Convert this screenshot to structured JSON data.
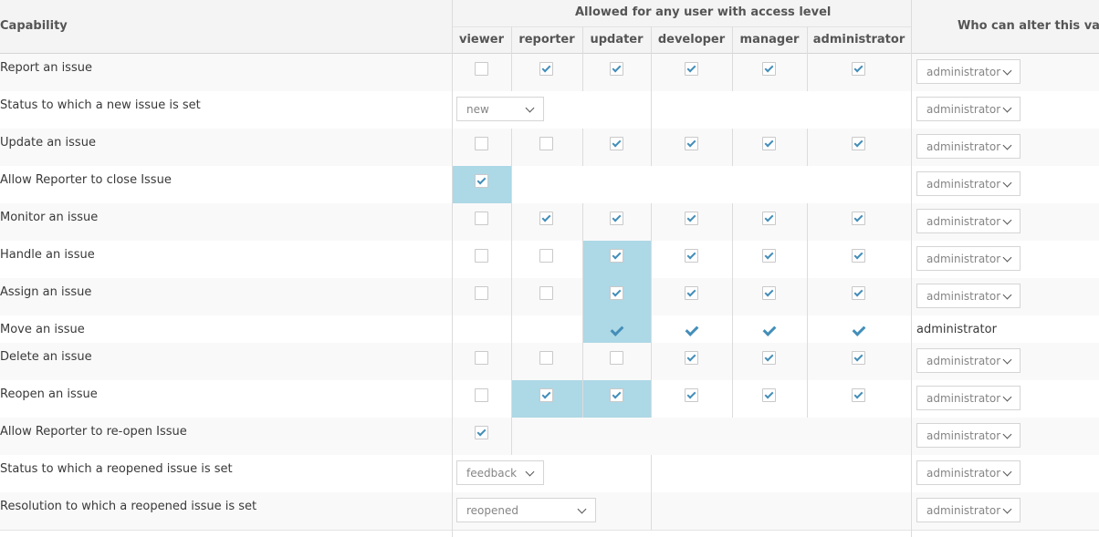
{
  "header": {
    "capability": "Capability",
    "allowed_group": "Allowed for any user with access level",
    "who_can_alter": "Who can alter this value",
    "levels": [
      "viewer",
      "reporter",
      "updater",
      "developer",
      "manager",
      "administrator"
    ]
  },
  "rows": [
    {
      "label": "Report an issue",
      "kind": "checks",
      "checks": [
        false,
        true,
        true,
        true,
        true,
        true
      ],
      "highlight": [
        false,
        false,
        false,
        false,
        false,
        false
      ],
      "alter": "administrator"
    },
    {
      "label": "Status to which a new issue is set",
      "kind": "select",
      "select_value": "new",
      "alter": "administrator"
    },
    {
      "label": "Update an issue",
      "kind": "checks",
      "checks": [
        false,
        false,
        true,
        true,
        true,
        true
      ],
      "highlight": [
        false,
        false,
        false,
        false,
        false,
        false
      ],
      "alter": "administrator"
    },
    {
      "label": "Allow Reporter to close Issue",
      "kind": "single",
      "checked": true,
      "highlight": true,
      "alter": "administrator"
    },
    {
      "label": "Monitor an issue",
      "kind": "checks",
      "checks": [
        false,
        true,
        true,
        true,
        true,
        true
      ],
      "highlight": [
        false,
        false,
        false,
        false,
        false,
        false
      ],
      "alter": "administrator"
    },
    {
      "label": "Handle an issue",
      "kind": "checks",
      "checks": [
        false,
        false,
        true,
        true,
        true,
        true
      ],
      "highlight": [
        false,
        false,
        true,
        false,
        false,
        false
      ],
      "alter": "administrator"
    },
    {
      "label": "Assign an issue",
      "kind": "checks",
      "checks": [
        false,
        false,
        true,
        true,
        true,
        true
      ],
      "highlight": [
        false,
        false,
        true,
        false,
        false,
        false
      ],
      "alter": "administrator"
    },
    {
      "label": "Move an issue",
      "kind": "ticks",
      "checks": [
        false,
        false,
        true,
        true,
        true,
        true
      ],
      "highlight": [
        false,
        false,
        true,
        false,
        false,
        false
      ],
      "alter": "administrator",
      "alter_plain": true
    },
    {
      "label": "Delete an issue",
      "kind": "checks",
      "checks": [
        false,
        false,
        false,
        true,
        true,
        true
      ],
      "highlight": [
        false,
        false,
        false,
        false,
        false,
        false
      ],
      "alter": "administrator"
    },
    {
      "label": "Reopen an issue",
      "kind": "checks",
      "checks": [
        false,
        true,
        true,
        true,
        true,
        true
      ],
      "highlight": [
        false,
        true,
        true,
        false,
        false,
        false
      ],
      "alter": "administrator"
    },
    {
      "label": "Allow Reporter to re-open Issue",
      "kind": "single",
      "checked": true,
      "highlight": false,
      "alter": "administrator"
    },
    {
      "label": "Status to which a reopened issue is set",
      "kind": "select",
      "select_value": "feedback",
      "alter": "administrator"
    },
    {
      "label": "Resolution to which a reopened issue is set",
      "kind": "select",
      "select_value": "reopened",
      "alter": "administrator"
    }
  ],
  "colors": {
    "accent": "#438eb9",
    "highlight": "#add8e6",
    "header_bg": "#f4f4f4"
  }
}
